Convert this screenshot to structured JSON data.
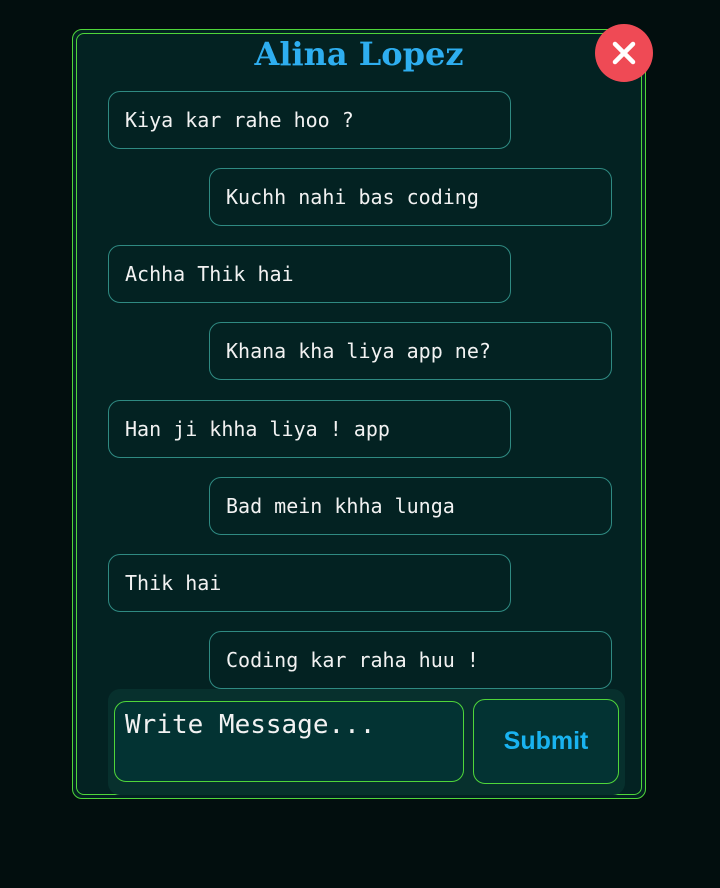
{
  "chat": {
    "title": "Alina Lopez",
    "messages": [
      {
        "side": "left",
        "text": "Kiya kar rahe hoo ?"
      },
      {
        "side": "right",
        "text": "Kuchh nahi bas coding"
      },
      {
        "side": "left",
        "text": "Achha Thik hai"
      },
      {
        "side": "right",
        "text": "Khana kha liya app ne?"
      },
      {
        "side": "left",
        "text": "Han ji khha liya ! app"
      },
      {
        "side": "right",
        "text": "Bad mein khha lunga"
      },
      {
        "side": "left",
        "text": "Thik hai"
      },
      {
        "side": "right",
        "text": "Coding kar raha huu !"
      }
    ]
  },
  "composer": {
    "placeholder": "Write Message...",
    "value": "",
    "submit_label": "Submit"
  },
  "close": {
    "icon": "close-icon"
  },
  "colors": {
    "page_background": "#020e0e",
    "panel_background": "#032222",
    "panel_border": "#4fd63a",
    "bubble_border": "#2f8a82",
    "title": "#2eaef0",
    "close_button": "#ef4a55",
    "submit_text": "#19b3f0"
  }
}
